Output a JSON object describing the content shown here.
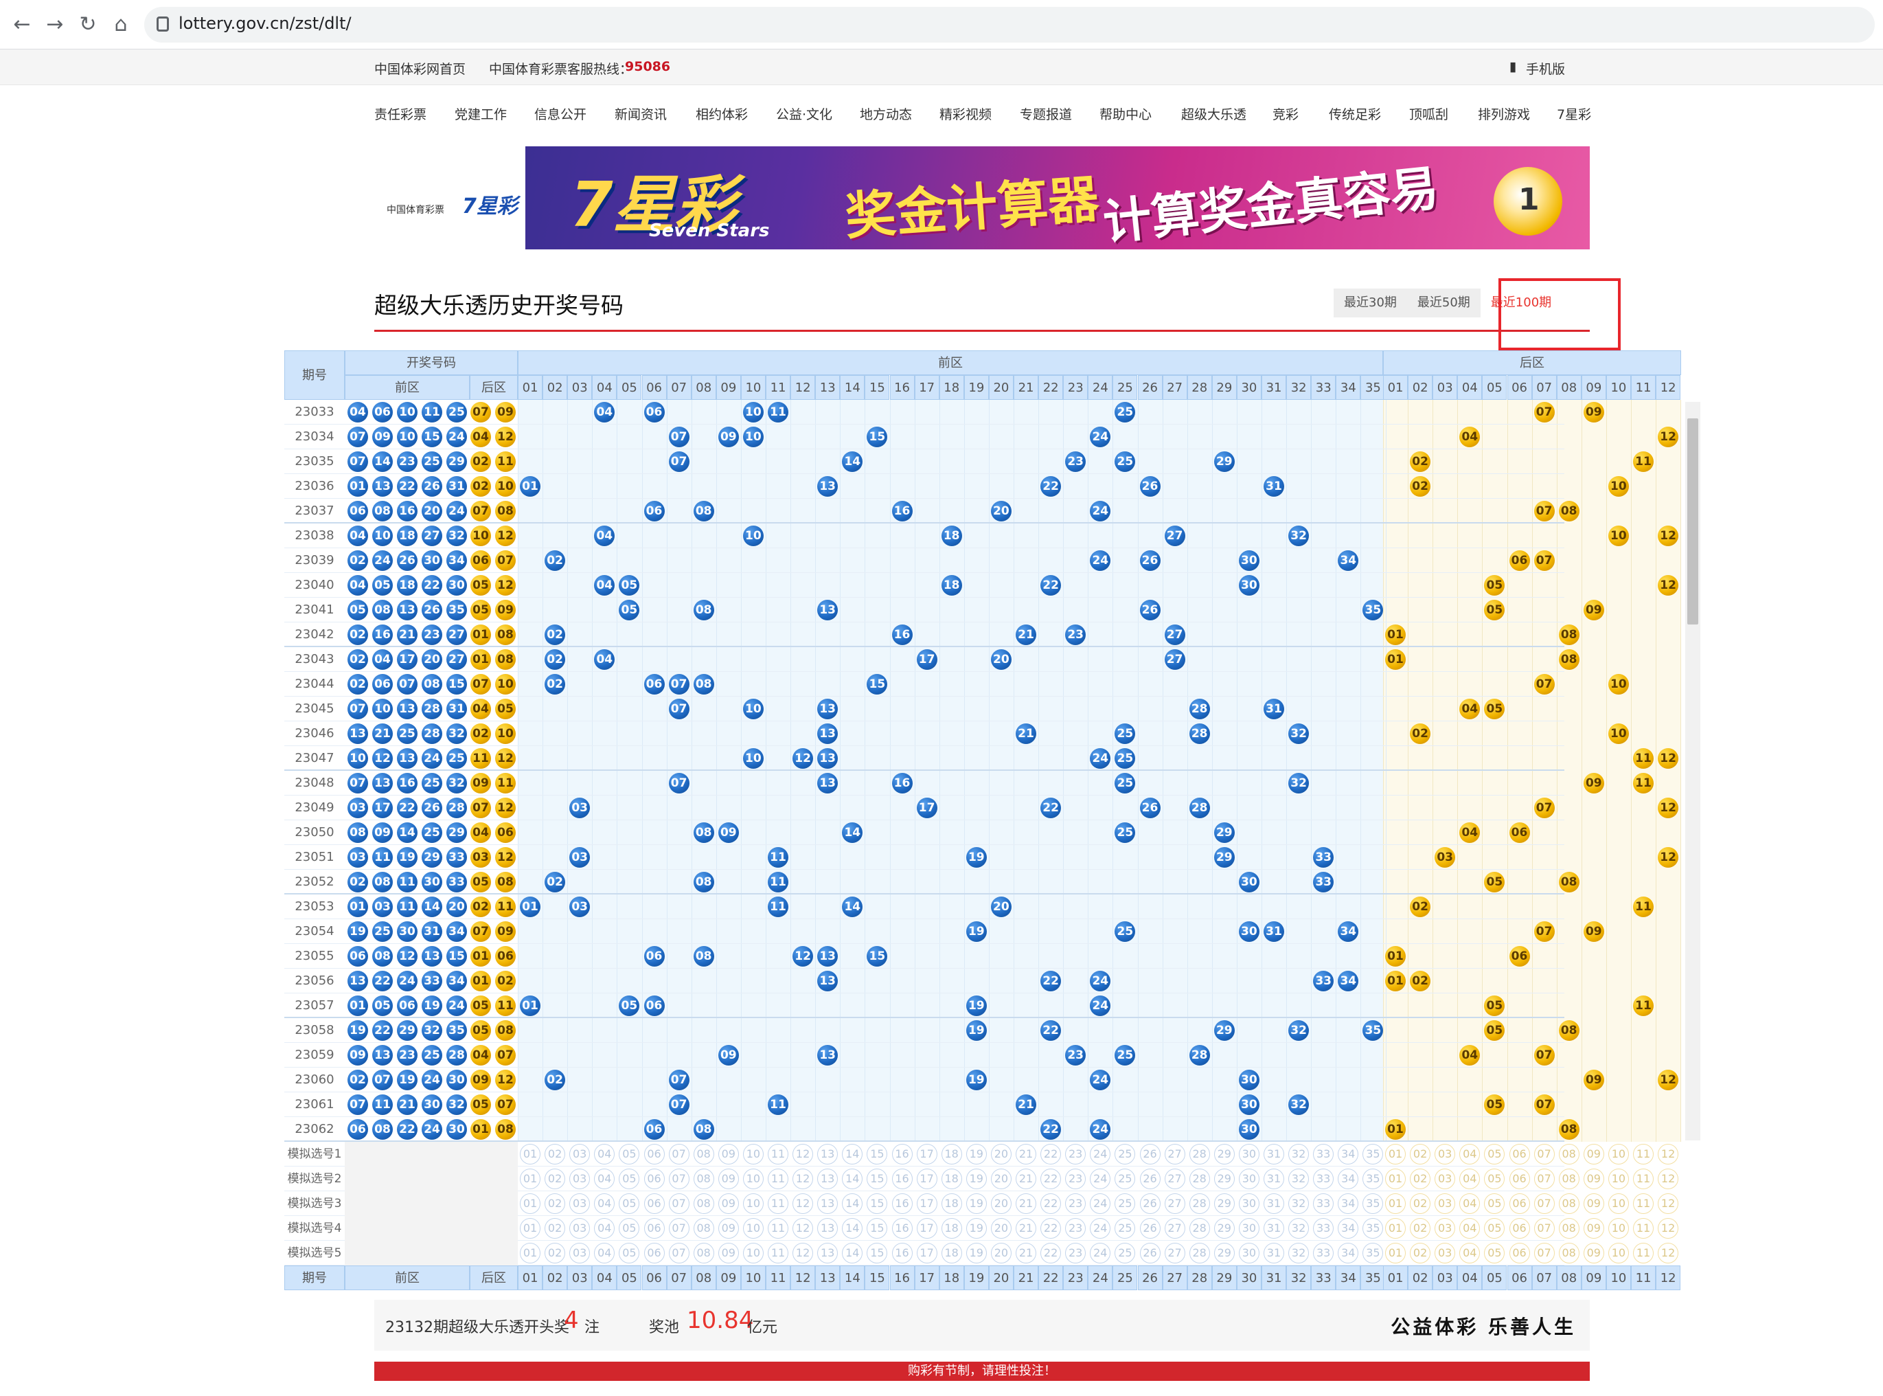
{
  "browser": {
    "url": "lottery.gov.cn/zst/dlt/"
  },
  "topbar": {
    "home": "中国体彩网首页",
    "hotline_label": "中国体育彩票客服热线：",
    "hotline": "95086",
    "mobile": "手机版"
  },
  "nav": [
    "责任彩票",
    "党建工作",
    "信息公开",
    "新闻资讯",
    "相约体彩",
    "公益·文化",
    "地方动态",
    "精彩视频",
    "专题报道",
    "帮助中心",
    "超级大乐透",
    "竞彩",
    "传统足彩",
    "顶呱刮",
    "排列游戏",
    "7星彩"
  ],
  "banner": {
    "logo_text": "中国体育彩票",
    "logo_game": "7星彩",
    "title": "7星彩",
    "subtitle": "Seven Stars",
    "calc": "奖金计算器",
    "slogan": "计算奖金真容易",
    "coin": "1"
  },
  "section": {
    "title": "超级大乐透历史开奖号码",
    "tabs": [
      "最近30期",
      "最近50期",
      "最近100期"
    ],
    "active_tab": "最近100期"
  },
  "chart": {
    "headers": {
      "issue": "期号",
      "draw": "开奖号码",
      "front_label": "前区",
      "back_label": "后区",
      "zone_front": "前区",
      "zone_back": "后区"
    },
    "sim_labels": [
      "模拟选号1",
      "模拟选号2",
      "模拟选号3",
      "模拟选号4",
      "模拟选号5"
    ],
    "rows": [
      {
        "issue": "23033",
        "front": [
          "04",
          "06",
          "10",
          "11",
          "25"
        ],
        "back": [
          "07",
          "09"
        ]
      },
      {
        "issue": "23034",
        "front": [
          "07",
          "09",
          "10",
          "15",
          "24"
        ],
        "back": [
          "04",
          "12"
        ]
      },
      {
        "issue": "23035",
        "front": [
          "07",
          "14",
          "23",
          "25",
          "29"
        ],
        "back": [
          "02",
          "11"
        ]
      },
      {
        "issue": "23036",
        "front": [
          "01",
          "13",
          "22",
          "26",
          "31"
        ],
        "back": [
          "02",
          "10"
        ]
      },
      {
        "issue": "23037",
        "front": [
          "06",
          "08",
          "16",
          "20",
          "24"
        ],
        "back": [
          "07",
          "08"
        ]
      },
      {
        "issue": "23038",
        "front": [
          "04",
          "10",
          "18",
          "27",
          "32"
        ],
        "back": [
          "10",
          "12"
        ]
      },
      {
        "issue": "23039",
        "front": [
          "02",
          "24",
          "26",
          "30",
          "34"
        ],
        "back": [
          "06",
          "07"
        ]
      },
      {
        "issue": "23040",
        "front": [
          "04",
          "05",
          "18",
          "22",
          "30"
        ],
        "back": [
          "05",
          "12"
        ]
      },
      {
        "issue": "23041",
        "front": [
          "05",
          "08",
          "13",
          "26",
          "35"
        ],
        "back": [
          "05",
          "09"
        ]
      },
      {
        "issue": "23042",
        "front": [
          "02",
          "16",
          "21",
          "23",
          "27"
        ],
        "back": [
          "01",
          "08"
        ]
      },
      {
        "issue": "23043",
        "front": [
          "02",
          "04",
          "17",
          "20",
          "27"
        ],
        "back": [
          "01",
          "08"
        ]
      },
      {
        "issue": "23044",
        "front": [
          "02",
          "06",
          "07",
          "08",
          "15"
        ],
        "back": [
          "07",
          "10"
        ]
      },
      {
        "issue": "23045",
        "front": [
          "07",
          "10",
          "13",
          "28",
          "31"
        ],
        "back": [
          "04",
          "05"
        ]
      },
      {
        "issue": "23046",
        "front": [
          "13",
          "21",
          "25",
          "28",
          "32"
        ],
        "back": [
          "02",
          "10"
        ]
      },
      {
        "issue": "23047",
        "front": [
          "10",
          "12",
          "13",
          "24",
          "25"
        ],
        "back": [
          "11",
          "12"
        ]
      },
      {
        "issue": "23048",
        "front": [
          "07",
          "13",
          "16",
          "25",
          "32"
        ],
        "back": [
          "09",
          "11"
        ]
      },
      {
        "issue": "23049",
        "front": [
          "03",
          "17",
          "22",
          "26",
          "28"
        ],
        "back": [
          "07",
          "12"
        ]
      },
      {
        "issue": "23050",
        "front": [
          "08",
          "09",
          "14",
          "25",
          "29"
        ],
        "back": [
          "04",
          "06"
        ]
      },
      {
        "issue": "23051",
        "front": [
          "03",
          "11",
          "19",
          "29",
          "33"
        ],
        "back": [
          "03",
          "12"
        ]
      },
      {
        "issue": "23052",
        "front": [
          "02",
          "08",
          "11",
          "30",
          "33"
        ],
        "back": [
          "05",
          "08"
        ]
      },
      {
        "issue": "23053",
        "front": [
          "01",
          "03",
          "11",
          "14",
          "20"
        ],
        "back": [
          "02",
          "11"
        ]
      },
      {
        "issue": "23054",
        "front": [
          "19",
          "25",
          "30",
          "31",
          "34"
        ],
        "back": [
          "07",
          "09"
        ]
      },
      {
        "issue": "23055",
        "front": [
          "06",
          "08",
          "12",
          "13",
          "15"
        ],
        "back": [
          "01",
          "06"
        ]
      },
      {
        "issue": "23056",
        "front": [
          "13",
          "22",
          "24",
          "33",
          "34"
        ],
        "back": [
          "01",
          "02"
        ]
      },
      {
        "issue": "23057",
        "front": [
          "01",
          "05",
          "06",
          "19",
          "24"
        ],
        "back": [
          "05",
          "11"
        ]
      },
      {
        "issue": "23058",
        "front": [
          "19",
          "22",
          "29",
          "32",
          "35"
        ],
        "back": [
          "05",
          "08"
        ]
      },
      {
        "issue": "23059",
        "front": [
          "09",
          "13",
          "23",
          "25",
          "28"
        ],
        "back": [
          "04",
          "07"
        ]
      },
      {
        "issue": "23060",
        "front": [
          "02",
          "07",
          "19",
          "24",
          "30"
        ],
        "back": [
          "09",
          "12"
        ]
      },
      {
        "issue": "23061",
        "front": [
          "07",
          "11",
          "21",
          "30",
          "32"
        ],
        "back": [
          "05",
          "07"
        ]
      },
      {
        "issue": "23062",
        "front": [
          "06",
          "08",
          "22",
          "24",
          "30"
        ],
        "back": [
          "01",
          "08"
        ]
      }
    ]
  },
  "jackpot": {
    "text1": "23132期超级大乐透开头奖",
    "count": "4",
    "unit1": "注",
    "pool_label": "奖池",
    "pool": "10.84",
    "unit2": "亿元",
    "motto": "公益体彩 乐善人生"
  },
  "notice": "购彩有节制，请理性投注！"
}
